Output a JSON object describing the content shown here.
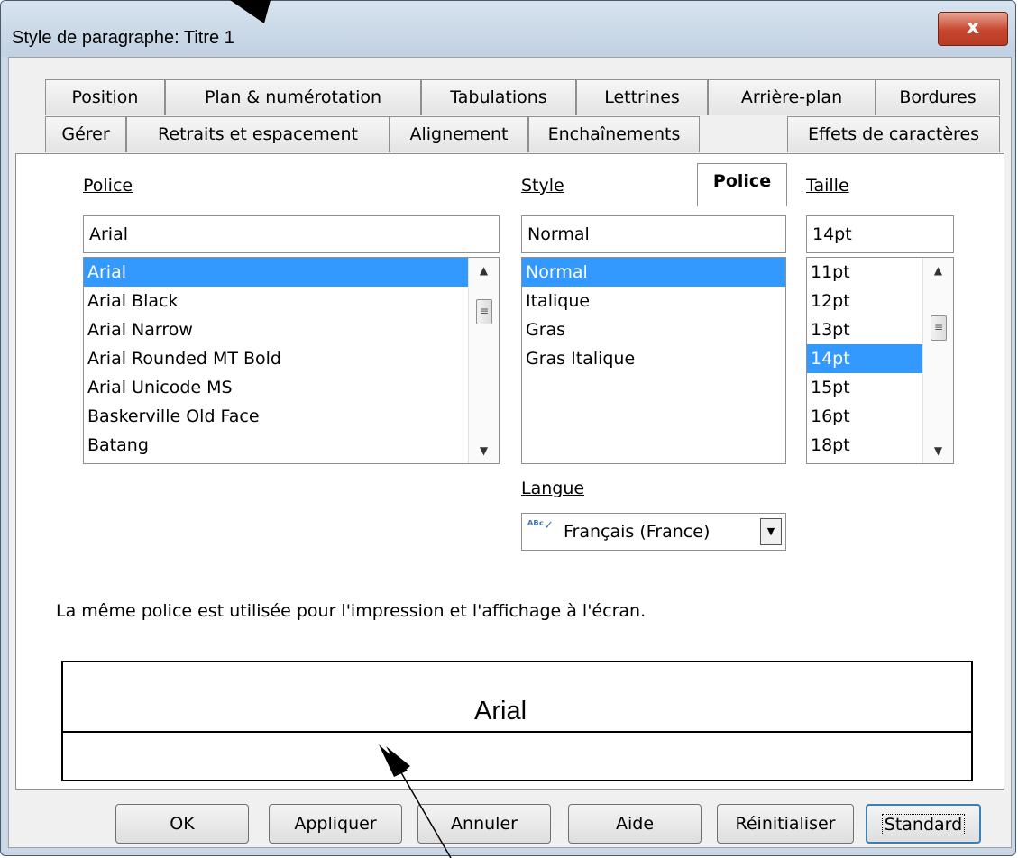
{
  "window": {
    "title": "Style de paragraphe: Titre 1",
    "close_label": "x"
  },
  "tabs_row1": [
    {
      "label": "Position"
    },
    {
      "label": "Plan & numérotation"
    },
    {
      "label": "Tabulations"
    },
    {
      "label": "Lettrines"
    },
    {
      "label": "Arrière-plan"
    },
    {
      "label": "Bordures"
    }
  ],
  "tabs_row2": [
    {
      "label": "Gérer"
    },
    {
      "label": "Retraits et espacement"
    },
    {
      "label": "Alignement"
    },
    {
      "label": "Enchaînements"
    },
    {
      "label": "Police",
      "active": true
    },
    {
      "label": "Effets de caractères"
    }
  ],
  "font": {
    "label": "Police",
    "value": "Arial",
    "items": [
      "Arial",
      "Arial Black",
      "Arial Narrow",
      "Arial Rounded MT Bold",
      "Arial Unicode MS",
      "Baskerville Old Face",
      "Batang"
    ],
    "selected": "Arial"
  },
  "style": {
    "label": "Style",
    "value": "Normal",
    "items": [
      "Normal",
      "Italique",
      "Gras",
      "Gras Italique"
    ],
    "selected": "Normal"
  },
  "size": {
    "label": "Taille",
    "value": "14pt",
    "items": [
      "11pt",
      "12pt",
      "13pt",
      "14pt",
      "15pt",
      "16pt",
      "18pt"
    ],
    "selected": "14pt"
  },
  "language": {
    "label": "Langue",
    "value": "Français (France)",
    "icon": "spellcheck-icon"
  },
  "info_text": "La même police est utilisée pour l'impression et l'affichage à l'écran.",
  "preview_text": "Arial",
  "buttons": {
    "ok": "OK",
    "apply": "Appliquer",
    "cancel": "Annuler",
    "help": "Aide",
    "reset": "Réinitialiser",
    "standard": "Standard"
  }
}
